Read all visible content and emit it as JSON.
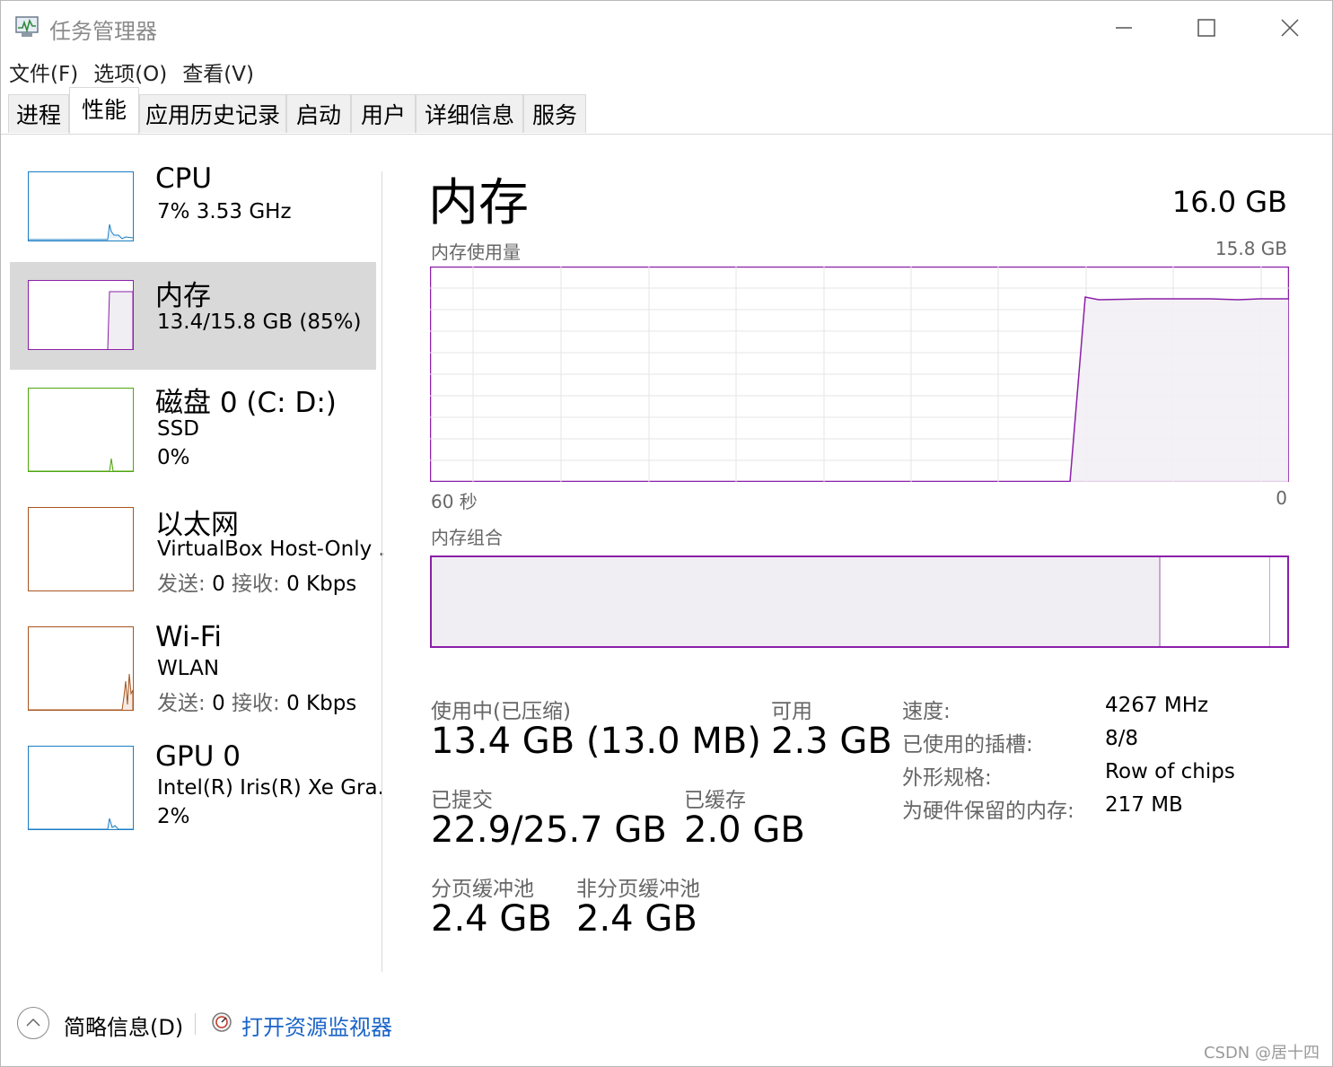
{
  "window": {
    "title": "任务管理器"
  },
  "menu": [
    "文件(F)",
    "选项(O)",
    "查看(V)"
  ],
  "tabs": [
    "进程",
    "性能",
    "应用历史记录",
    "启动",
    "用户",
    "详细信息",
    "服务"
  ],
  "active_tab": "性能",
  "sidebar": {
    "cpu": {
      "title": "CPU",
      "line1": "7%  3.53 GHz",
      "color": "#1a7dc4"
    },
    "memory": {
      "title": "内存",
      "line1": "13.4/15.8 GB (85%)",
      "color": "#8b1fa9"
    },
    "disk": {
      "title": "磁盘 0 (C: D:)",
      "line1": "SSD",
      "line2": "0%",
      "color": "#4da60c"
    },
    "ethernet": {
      "title": "以太网",
      "line1": "VirtualBox Host-Only ...",
      "send_label": "发送:",
      "send_value": "0",
      "recv_label": "接收:",
      "recv_value": "0 Kbps",
      "color": "#a7541d"
    },
    "wifi": {
      "title": "Wi-Fi",
      "line1": "WLAN",
      "send_label": "发送:",
      "send_value": "0",
      "recv_label": "接收:",
      "recv_value": "0 Kbps",
      "color": "#a7541d"
    },
    "gpu": {
      "title": "GPU 0",
      "line1": "Intel(R) Iris(R) Xe Gra...",
      "line2": "2%",
      "color": "#1a7dc4"
    }
  },
  "main": {
    "title": "内存",
    "total": "16.0 GB",
    "usage_label": "内存使用量",
    "usage_max": "15.8 GB",
    "axis_left": "60 秒",
    "axis_right": "0",
    "composition_label": "内存组合",
    "usage_fraction_used": 0.852,
    "usage_fraction_standby": 0.127,
    "stats": {
      "in_use_label": "使用中(已压缩)",
      "in_use_value": "13.4 GB (13.0 MB)",
      "available_label": "可用",
      "available_value": "2.3 GB",
      "committed_label": "已提交",
      "committed_value": "22.9/25.7 GB",
      "cached_label": "已缓存",
      "cached_value": "2.0 GB",
      "paged_label": "分页缓冲池",
      "paged_value": "2.4 GB",
      "nonpaged_label": "非分页缓冲池",
      "nonpaged_value": "2.4 GB"
    },
    "details": [
      {
        "label": "速度:",
        "value": "4267 MHz"
      },
      {
        "label": "已使用的插槽:",
        "value": "8/8"
      },
      {
        "label": "外形规格:",
        "value": "Row of chips"
      },
      {
        "label": "为硬件保留的内存:",
        "value": "217 MB"
      }
    ]
  },
  "footer": {
    "summary_label": "简略信息(D)",
    "resource_monitor_label": "打开资源监视器",
    "watermark": "CSDN @居十四"
  }
}
